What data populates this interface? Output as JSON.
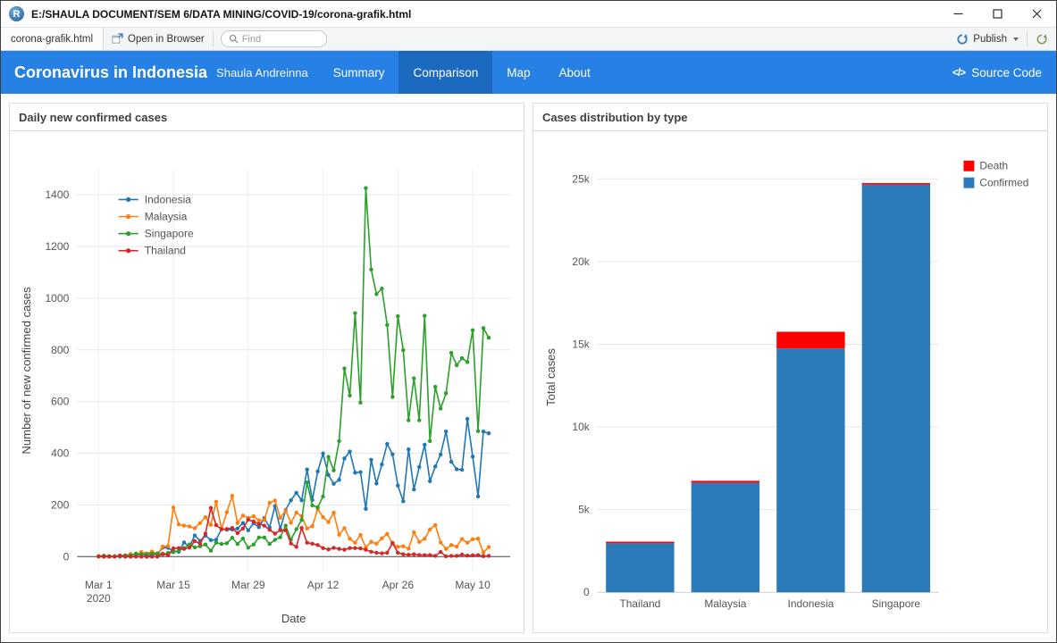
{
  "app_icon_letter": "R",
  "window": {
    "title": "E:/SHAULA DOCUMENT/SEM 6/DATA MINING/COVID-19/corona-grafik.html"
  },
  "toolbar": {
    "tab_label": "corona-grafik.html",
    "open_in_browser_label": "Open in Browser",
    "find_placeholder": "Find",
    "publish_label": "Publish"
  },
  "navbar": {
    "brand": "Coronavirus in Indonesia",
    "author": "Shaula Andreinna",
    "items": [
      {
        "label": "Summary",
        "active": false
      },
      {
        "label": "Comparison",
        "active": true
      },
      {
        "label": "Map",
        "active": false
      },
      {
        "label": "About",
        "active": false
      }
    ],
    "code_icon": "</>",
    "source_code_label": "Source Code"
  },
  "panels": {
    "left": {
      "title": "Daily new confirmed cases"
    },
    "right": {
      "title": "Cases distribution by type"
    }
  },
  "colors": {
    "navbar_bg": "#2780e3",
    "navbar_active_bg": "#1c6ac0"
  },
  "chart_data": [
    {
      "type": "line",
      "title": "Daily new confirmed cases",
      "xlabel": "Date",
      "ylabel": "Number of new confirmed cases",
      "x_start_date": "2020-03-01",
      "x_unit": "day",
      "ylim": [
        -60,
        1500
      ],
      "yticks": [
        0,
        200,
        400,
        600,
        800,
        1000,
        1200,
        1400
      ],
      "xticks": [
        {
          "i": 0,
          "label": "Mar 1\n2020"
        },
        {
          "i": 14,
          "label": "Mar 15"
        },
        {
          "i": 28,
          "label": "Mar 29"
        },
        {
          "i": 42,
          "label": "Apr 12"
        },
        {
          "i": 56,
          "label": "Apr 26"
        },
        {
          "i": 70,
          "label": "May 10"
        }
      ],
      "grid": true,
      "legend_position": "top-left",
      "series": [
        {
          "name": "Indonesia",
          "color": "#1f77b4",
          "values": [
            0,
            0,
            2,
            0,
            0,
            0,
            0,
            2,
            13,
            0,
            8,
            8,
            35,
            34,
            21,
            19,
            55,
            38,
            82,
            61,
            81,
            64,
            65,
            107,
            104,
            105,
            109,
            130,
            102,
            129,
            114,
            149,
            113,
            196,
            106,
            181,
            218,
            247,
            218,
            337,
            219,
            330,
            399,
            316,
            282,
            297,
            380,
            407,
            325,
            327,
            185,
            375,
            283,
            357,
            436,
            396,
            275,
            214,
            415,
            260,
            347,
            433,
            292,
            349,
            395,
            484,
            367,
            338,
            336,
            533,
            387,
            233,
            484,
            477
          ]
        },
        {
          "name": "Malaysia",
          "color": "#ff7f0e",
          "values": [
            0,
            0,
            0,
            0,
            5,
            4,
            10,
            6,
            18,
            12,
            20,
            9,
            39,
            41,
            190,
            125,
            120,
            117,
            110,
            130,
            153,
            123,
            212,
            106,
            172,
            235,
            130,
            159,
            150,
            156,
            140,
            142,
            208,
            217,
            150,
            179,
            131,
            170,
            156,
            109,
            118,
            184,
            153,
            134,
            170,
            85,
            110,
            69,
            54,
            84,
            36,
            57,
            50,
            71,
            88,
            51,
            38,
            40,
            31,
            94,
            57,
            69,
            105,
            122,
            55,
            30,
            45,
            39,
            68,
            54,
            67,
            70,
            16,
            37
          ]
        },
        {
          "name": "Singapore",
          "color": "#2ca02c",
          "values": [
            2,
            4,
            2,
            2,
            2,
            5,
            6,
            12,
            9,
            10,
            12,
            13,
            9,
            14,
            17,
            23,
            33,
            47,
            36,
            40,
            47,
            23,
            54,
            49,
            52,
            73,
            49,
            70,
            35,
            47,
            74,
            74,
            49,
            65,
            75,
            120,
            66,
            106,
            142,
            287,
            198,
            191,
            233,
            386,
            334,
            447,
            728,
            623,
            942,
            596,
            1426,
            1111,
            1016,
            1037,
            897,
            618,
            931,
            799,
            528,
            690,
            528,
            932,
            447,
            657,
            573,
            632,
            788,
            741,
            768,
            753,
            876,
            486,
            884,
            847
          ]
        },
        {
          "name": "Thailand",
          "color": "#d62728",
          "values": [
            1,
            0,
            0,
            0,
            4,
            0,
            0,
            0,
            0,
            0,
            0,
            0,
            11,
            5,
            32,
            33,
            30,
            35,
            60,
            50,
            89,
            188,
            122,
            106,
            107,
            111,
            91,
            109,
            143,
            136,
            127,
            120,
            104,
            89,
            102,
            102,
            51,
            38,
            111,
            54,
            50,
            45,
            33,
            28,
            34,
            30,
            27,
            33,
            33,
            32,
            27,
            19,
            15,
            13,
            15,
            53,
            15,
            9,
            7,
            9,
            6,
            6,
            6,
            3,
            18,
            1,
            3,
            3,
            8,
            4,
            5,
            6,
            2,
            3
          ]
        }
      ]
    },
    {
      "type": "bar",
      "stacked": true,
      "title": "Cases distribution by type",
      "xlabel": "",
      "ylabel": "Total cases",
      "categories": [
        "Thailand",
        "Malaysia",
        "Indonesia",
        "Singapore"
      ],
      "ylim": [
        0,
        26000
      ],
      "yticks": [
        {
          "v": 0,
          "label": "0"
        },
        {
          "v": 5000,
          "label": "5k"
        },
        {
          "v": 10000,
          "label": "10k"
        },
        {
          "v": 15000,
          "label": "15k"
        },
        {
          "v": 20000,
          "label": "20k"
        },
        {
          "v": 25000,
          "label": "25k"
        }
      ],
      "grid": true,
      "legend_position": "top-right",
      "series": [
        {
          "name": "Death",
          "color": "#ff0000",
          "values": [
            56,
            109,
            1007,
            21
          ]
        },
        {
          "name": "Confirmed",
          "color": "#2b7bba",
          "values": [
            2964,
            6633,
            14749,
            24650
          ]
        }
      ]
    }
  ]
}
